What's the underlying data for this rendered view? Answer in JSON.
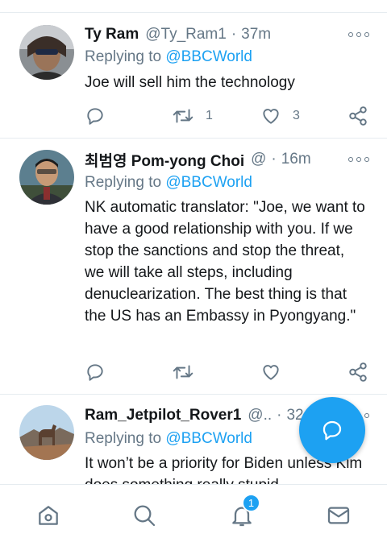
{
  "tweets": [
    {
      "name": "Ty Ram",
      "handle": "@Ty_Ram1",
      "separator": "·",
      "time": "37m",
      "replying_prefix": "Replying to",
      "replying_to": "@BBCWorld",
      "body": "Joe will sell him the technology",
      "retweets": "1",
      "likes": "3"
    },
    {
      "name": "최범영 Pom-yong Choi",
      "handle": "@",
      "separator": "·",
      "time": "16m",
      "replying_prefix": "Replying to",
      "replying_to": "@BBCWorld",
      "body": "NK automatic translator: \"Joe, we want to have a good relationship with you. If we stop the sanctions and stop the threat, we will take all steps, including denuclearization. The best thing is that the US has an Embassy in Pyongyang.\"",
      "retweets": "",
      "likes": ""
    },
    {
      "name": "Ram_Jetpilot_Rover1",
      "handle": "@..",
      "separator": "·",
      "time": "32",
      "replying_prefix": "Replying to",
      "replying_to": "@BBCWorld",
      "body": "It won’t be a priority for Biden unless Kim does something really stupid"
    }
  ],
  "notifications_badge": "1",
  "colors": {
    "accent": "#1da1f2",
    "muted": "#657786",
    "text": "#14171a",
    "divider": "#e6ecf0"
  },
  "icons": [
    "more-icon",
    "reply-icon",
    "retweet-icon",
    "like-icon",
    "share-icon",
    "compose-icon",
    "home-icon",
    "search-icon",
    "notifications-icon",
    "messages-icon"
  ]
}
